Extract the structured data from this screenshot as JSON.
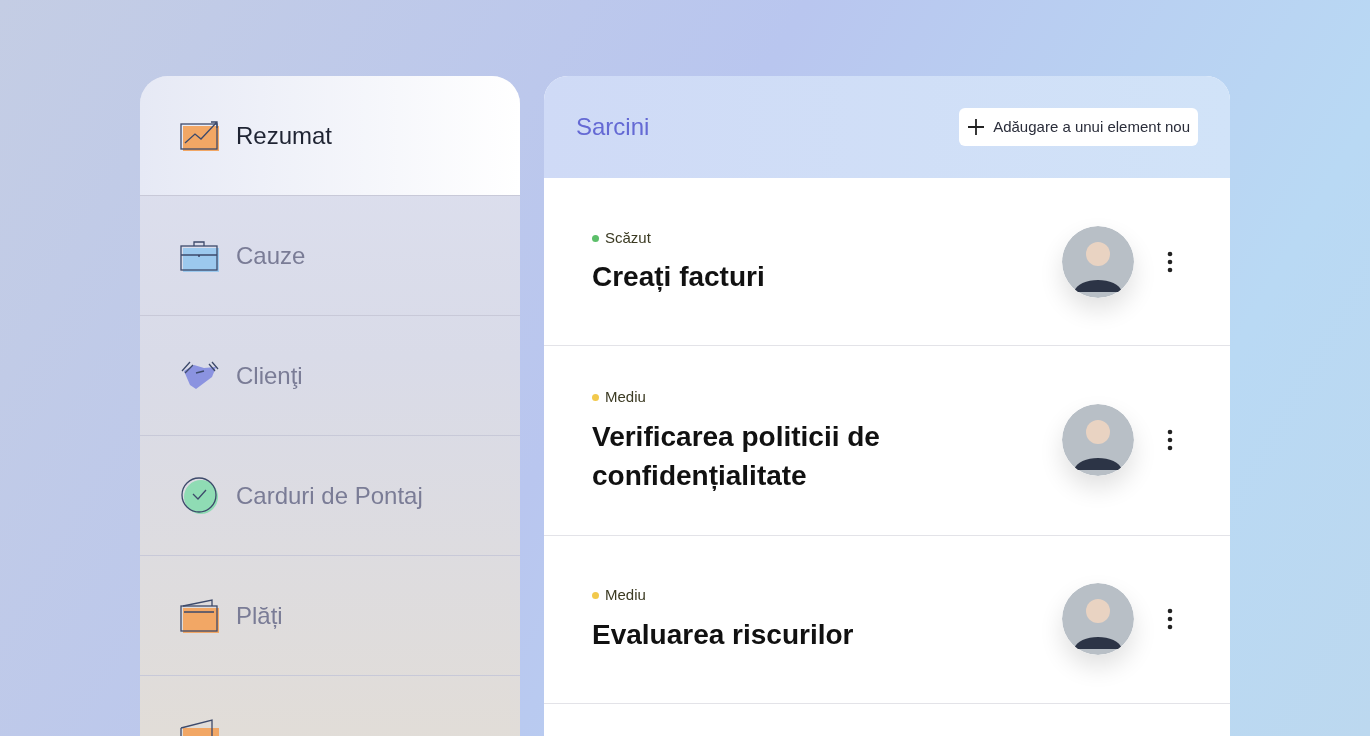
{
  "sidebar": {
    "items": [
      {
        "label": "Rezumat",
        "kind": "chart",
        "selected": true
      },
      {
        "label": "Cauze",
        "kind": "briefcase",
        "selected": false
      },
      {
        "label": "Clienţi",
        "kind": "handshake",
        "selected": false
      },
      {
        "label": "Carduri de Pontaj",
        "kind": "check",
        "selected": false
      },
      {
        "label": "Plăți",
        "kind": "wallet",
        "selected": false
      },
      {
        "kind": "folder",
        "selected": false
      }
    ]
  },
  "panel": {
    "title": "Sarcini",
    "add_button": "Adăugare a unui element nou",
    "tasks": [
      {
        "priority": "Scăzut",
        "color": "#5cbf6a",
        "title": "Creați facturi"
      },
      {
        "priority": "Mediu",
        "color": "#f2c94c",
        "title": "Verificarea politicii de confidențialitate"
      },
      {
        "priority": "Mediu",
        "color": "#f2c94c",
        "title": "Evaluarea riscurilor"
      }
    ]
  }
}
